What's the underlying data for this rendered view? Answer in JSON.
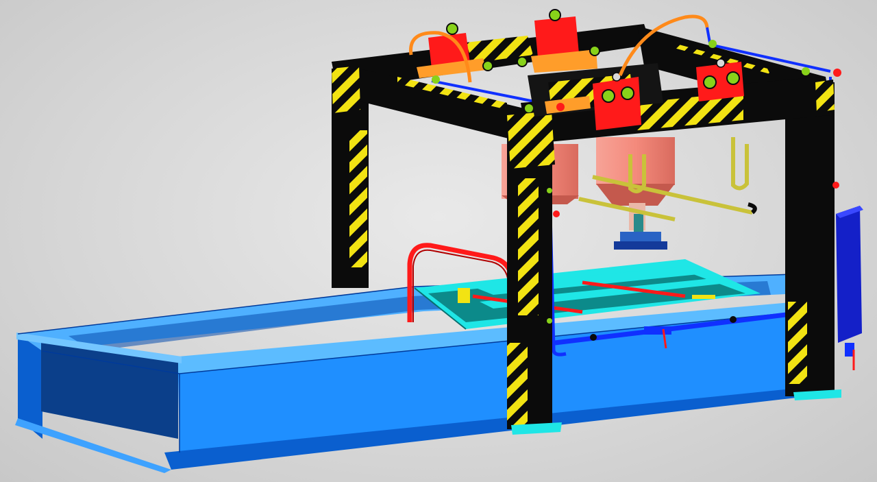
{
  "viewport": {
    "background_top": "#eaeaea",
    "background_bottom": "#c9c9c9"
  },
  "colors": {
    "tank_blue": "#1f8fff",
    "tank_blue_dark": "#0a5fcf",
    "tank_edge": "#003a9a",
    "frame_black": "#0b0b0b",
    "hazard_yellow": "#f2e313",
    "cart_red": "#ff1a1a",
    "hose_orange": "#ff8a1a",
    "bracket_orange": "#ff9d2a",
    "cyan_frame": "#1fe6e6",
    "salmon_cylinder": "#f48a7c",
    "pipe_blue": "#1030ff",
    "cabinet_blue": "#1420c8",
    "wheel_green": "#88d21a",
    "rail_olive": "#c9c23a"
  },
  "model": {
    "object": "gantry-frame-over-tank",
    "view": "isometric-shaded"
  }
}
